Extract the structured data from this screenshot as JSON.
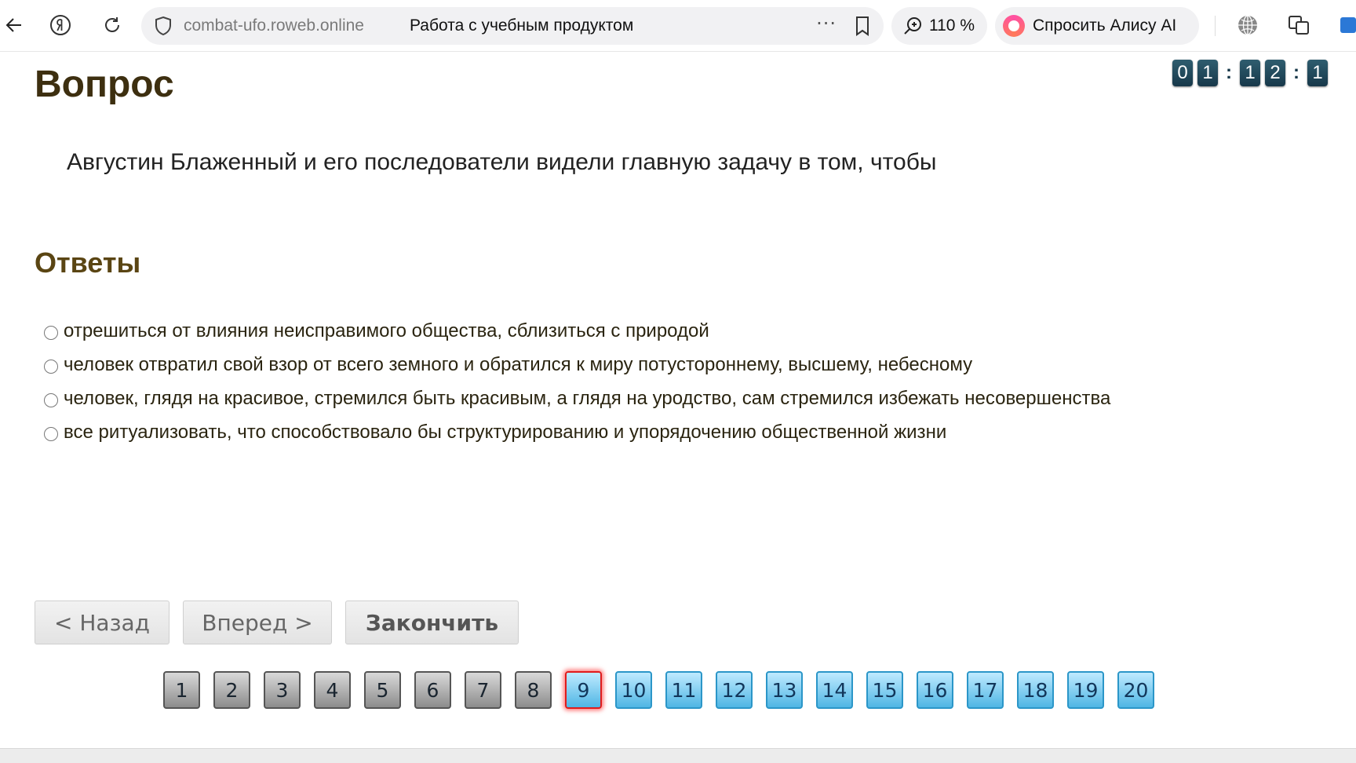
{
  "browser": {
    "domain": "combat-ufo.roweb.online",
    "page_title": "Работа с учебным продуктом",
    "menu_dots": "···",
    "zoom": "110 %",
    "alice_label": "Спросить Алису AI"
  },
  "page": {
    "title": "Вопрос",
    "timer": {
      "d1": "0",
      "d2": "1",
      "sep1": ":",
      "d3": "1",
      "d4": "2",
      "sep2": ":",
      "d5": "1"
    },
    "question": "Августин Блаженный и его последователи видели главную задачу в том, чтобы",
    "answers_title": "Ответы",
    "answers": [
      "отрешиться от влияния неисправимого общества, сблизиться с природой",
      "человек отвратил свой взор от всего земного и обратился к миру потустороннему, высшему, небесному",
      "человек, глядя на красивое, стремился быть красивым, а глядя на уродство, сам стремился избежать несовершенства",
      "все ритуализовать, что способствовало бы структурированию и упорядочению общественной жизни"
    ],
    "buttons": {
      "back": "< Назад",
      "next": "Вперед >",
      "finish": "Закончить"
    },
    "pager": {
      "current": 9,
      "answered_count": 8,
      "pages": [
        "1",
        "2",
        "3",
        "4",
        "5",
        "6",
        "7",
        "8",
        "9",
        "10",
        "11",
        "12",
        "13",
        "14",
        "15",
        "16",
        "17",
        "18",
        "19",
        "20"
      ]
    }
  }
}
